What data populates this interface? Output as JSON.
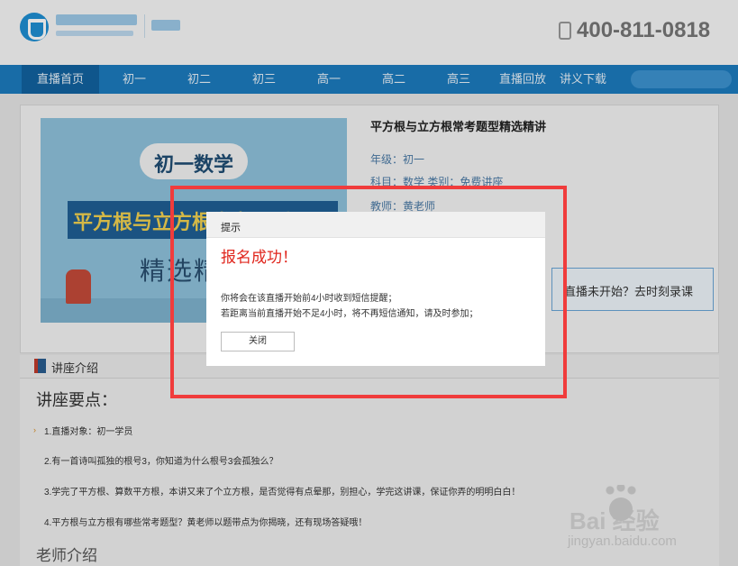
{
  "header": {
    "phone": "400-811-0818"
  },
  "nav": {
    "items": [
      "直播首页",
      "初一",
      "初二",
      "初三",
      "高一",
      "高二",
      "高三",
      "直播回放",
      "讲义下载"
    ]
  },
  "course": {
    "image": {
      "subject_badge": "初一数学",
      "band_text": "平方根与立方根常考题型",
      "subtitle": "精选精讲"
    },
    "title": "平方根与立方根常考题型精选精讲",
    "grade": "年级：初一",
    "subject_category": "科目：数学    类别：免费讲座",
    "teacher": "教师：黄老师",
    "status_button": "直播未开始？去时刻录课"
  },
  "section": {
    "title": "讲座介绍"
  },
  "points": {
    "heading": "讲座要点：",
    "items": [
      "1.直播对象：初一学员",
      "2.有一首诗叫孤独的根号3，你知道为什么根号3会孤独么？",
      "3.学完了平方根、算数平方根，本讲又来了个立方根，是否觉得有点晕那，别担心，学完这讲课，保证你弄的明明白白！",
      "4.平方根与立方根有哪些常考题型？黄老师以题带点为你揭晓，还有现场答疑哦！"
    ],
    "next_heading": "老师介绍"
  },
  "dialog": {
    "title": "提示",
    "success": "报名成功！",
    "message_1": "你将会在该直播开始前4小时收到短信提醒；",
    "message_2": "若距离当前直播开始不足4小时，将不再短信通知，请及时参加；",
    "close_label": "关闭"
  },
  "watermark": {
    "text": "Bai  经验",
    "url": "jingyan.baidu.com"
  },
  "colors": {
    "nav": "#1c7cbf",
    "nav_active": "#1262a0",
    "highlight": "#f03c3c",
    "success": "#e0261d"
  }
}
